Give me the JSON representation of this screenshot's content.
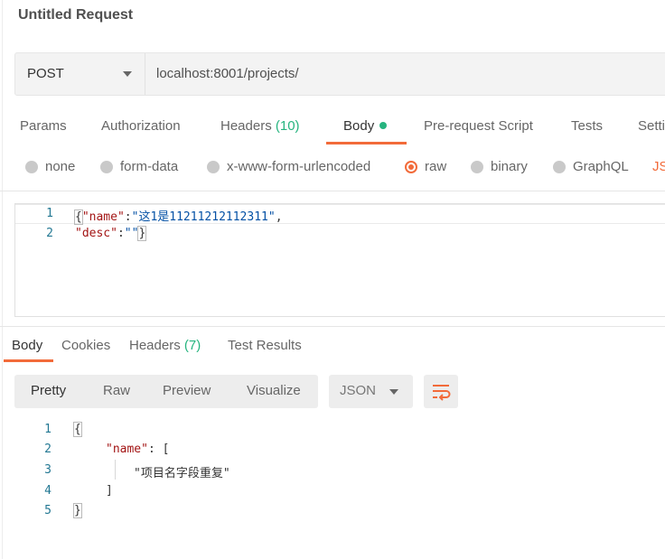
{
  "request": {
    "title": "Untitled Request",
    "method": "POST",
    "url": "localhost:8001/projects/"
  },
  "request_tabs": [
    {
      "label": "Params"
    },
    {
      "label": "Authorization"
    },
    {
      "label": "Headers",
      "count": "(10)"
    },
    {
      "label": "Body"
    },
    {
      "label": "Pre-request Script"
    },
    {
      "label": "Tests"
    },
    {
      "label": "Setti"
    }
  ],
  "body_modes": [
    {
      "label": "none"
    },
    {
      "label": "form-data"
    },
    {
      "label": "x-www-form-urlencoded"
    },
    {
      "label": "raw"
    },
    {
      "label": "binary"
    },
    {
      "label": "GraphQL"
    }
  ],
  "body_format_partial": "JS",
  "request_body": {
    "line_numbers": [
      "1",
      "2"
    ],
    "line1": {
      "open": "{",
      "key": "\"name\"",
      "colon": ":",
      "value": "\"这1是11211212112311\"",
      "comma": ","
    },
    "line2": {
      "key": "\"desc\"",
      "colon": ":",
      "value": "\"\"",
      "close": "}"
    }
  },
  "response_tabs": [
    {
      "label": "Body"
    },
    {
      "label": "Cookies"
    },
    {
      "label": "Headers",
      "count": "(7)"
    },
    {
      "label": "Test Results"
    }
  ],
  "view_modes": [
    {
      "label": "Pretty"
    },
    {
      "label": "Raw"
    },
    {
      "label": "Preview"
    },
    {
      "label": "Visualize"
    }
  ],
  "response_format": "JSON",
  "response_body": {
    "line_numbers": [
      "1",
      "2",
      "3",
      "4",
      "5"
    ],
    "line1": "{",
    "line2": {
      "key": "\"name\"",
      "rest": ": ["
    },
    "line3": "\"项目名字段重复\"",
    "line4": "]",
    "line5": "}"
  },
  "colors": {
    "accent": "#f26b3a",
    "count_green": "#26b47f",
    "json_key": "#a31515",
    "json_string": "#0451a5",
    "line_number": "#237893"
  },
  "icons": [
    "chevron-down-icon",
    "radio-icon",
    "wrap-lines-icon"
  ]
}
